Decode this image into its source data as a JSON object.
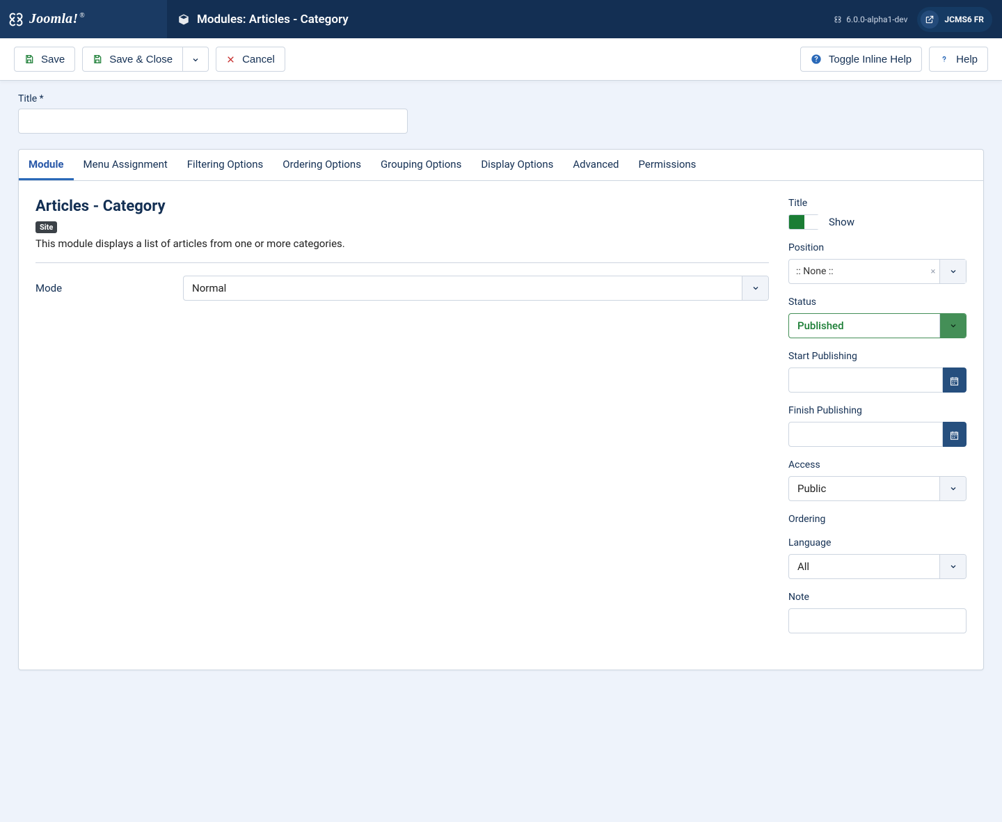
{
  "header": {
    "brand": "Joomla!",
    "page_title": "Modules: Articles - Category",
    "version": "6.0.0-alpha1-dev",
    "user": "JCMS6 FR"
  },
  "toolbar": {
    "save": "Save",
    "save_close": "Save & Close",
    "cancel": "Cancel",
    "toggle_help": "Toggle Inline Help",
    "help": "Help"
  },
  "form": {
    "title_label": "Title *",
    "title_value": ""
  },
  "tabs": [
    {
      "id": "module",
      "label": "Module",
      "active": true
    },
    {
      "id": "menu",
      "label": "Menu Assignment"
    },
    {
      "id": "filter",
      "label": "Filtering Options"
    },
    {
      "id": "order",
      "label": "Ordering Options"
    },
    {
      "id": "group",
      "label": "Grouping Options"
    },
    {
      "id": "display",
      "label": "Display Options"
    },
    {
      "id": "advanced",
      "label": "Advanced"
    },
    {
      "id": "perm",
      "label": "Permissions"
    }
  ],
  "module": {
    "heading": "Articles - Category",
    "scope_badge": "Site",
    "description": "This module displays a list of articles from one or more categories.",
    "mode_label": "Mode",
    "mode_value": "Normal"
  },
  "side": {
    "title_label": "Title",
    "title_toggle_text": "Show",
    "position_label": "Position",
    "position_value": ":: None ::",
    "status_label": "Status",
    "status_value": "Published",
    "start_publishing_label": "Start Publishing",
    "start_publishing_value": "",
    "finish_publishing_label": "Finish Publishing",
    "finish_publishing_value": "",
    "access_label": "Access",
    "access_value": "Public",
    "ordering_label": "Ordering",
    "language_label": "Language",
    "language_value": "All",
    "note_label": "Note",
    "note_value": ""
  }
}
